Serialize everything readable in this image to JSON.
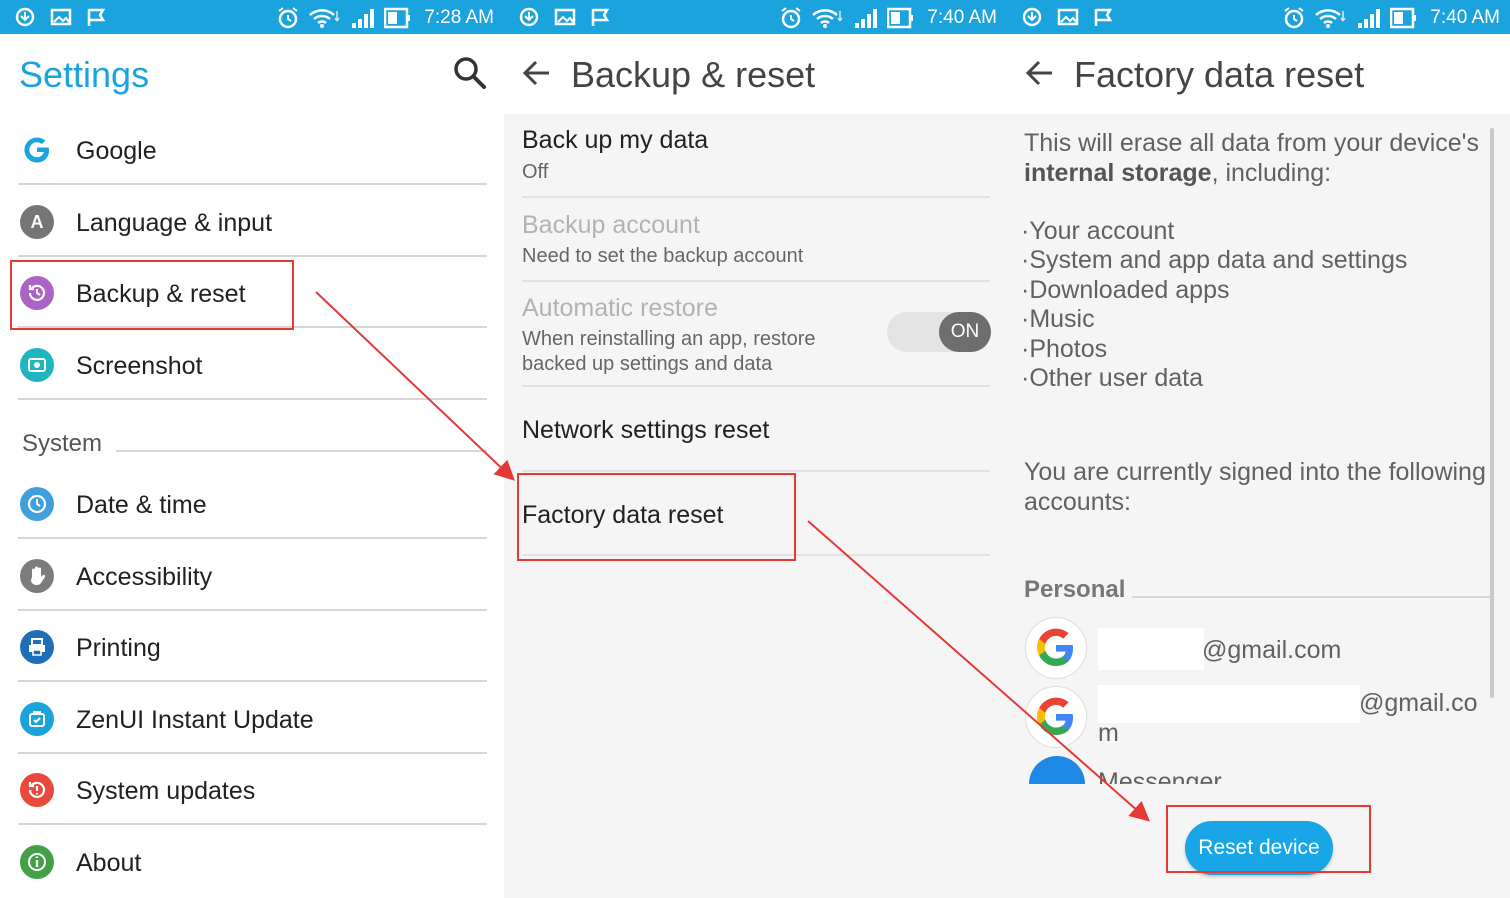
{
  "panel1": {
    "status_time": "7:28 AM",
    "title": "Settings",
    "items": [
      {
        "label": "Google",
        "icon": "google-icon",
        "color": "#1aa3dd"
      },
      {
        "label": "Language & input",
        "icon": "language-icon",
        "color": "#757575"
      },
      {
        "label": "Backup & reset",
        "icon": "backup-icon",
        "color": "#ab63c6"
      },
      {
        "label": "Screenshot",
        "icon": "screenshot-icon",
        "color": "#1fb6c0"
      }
    ],
    "section": "System",
    "system_items": [
      {
        "label": "Date & time",
        "icon": "clock-icon",
        "color": "#3fa0dd"
      },
      {
        "label": "Accessibility",
        "icon": "hand-icon",
        "color": "#7c7c7c"
      },
      {
        "label": "Printing",
        "icon": "printer-icon",
        "color": "#1e6fb8"
      },
      {
        "label": "ZenUI Instant Update",
        "icon": "update-icon",
        "color": "#1aa3dd"
      },
      {
        "label": "System updates",
        "icon": "system-update-icon",
        "color": "#e9493a"
      },
      {
        "label": "About",
        "icon": "info-icon",
        "color": "#43a047"
      }
    ]
  },
  "panel2": {
    "status_time": "7:40 AM",
    "title": "Backup & reset",
    "backup_data": {
      "title": "Back up my data",
      "summary": "Off"
    },
    "backup_account": {
      "title": "Backup account",
      "summary": "Need to set the backup account"
    },
    "auto_restore": {
      "title": "Automatic restore",
      "summary_line1": "When reinstalling an app, restore",
      "summary_line2": "backed up settings and data",
      "toggle_label": "ON"
    },
    "network_reset": "Network settings reset",
    "factory_reset": "Factory data reset"
  },
  "panel3": {
    "status_time": "7:40 AM",
    "title": "Factory data reset",
    "intro_line1": "This will erase all data from your device's",
    "intro_bold": "internal storage",
    "intro_rest": ", including:",
    "bullets": [
      "Your account",
      "System and app data and settings",
      "Downloaded apps",
      "Music",
      "Photos",
      "Other user data"
    ],
    "signed_in_line1": "You are currently signed into the following",
    "signed_in_line2": "accounts:",
    "personal": "Personal",
    "account1": "@gmail.com",
    "account2": "@gmail.co",
    "account2_wrap": "m",
    "messenger": "Messenger",
    "reset_button": "Reset device"
  },
  "colors": {
    "accent": "#1aa3dd",
    "highlight": "#e53935"
  }
}
